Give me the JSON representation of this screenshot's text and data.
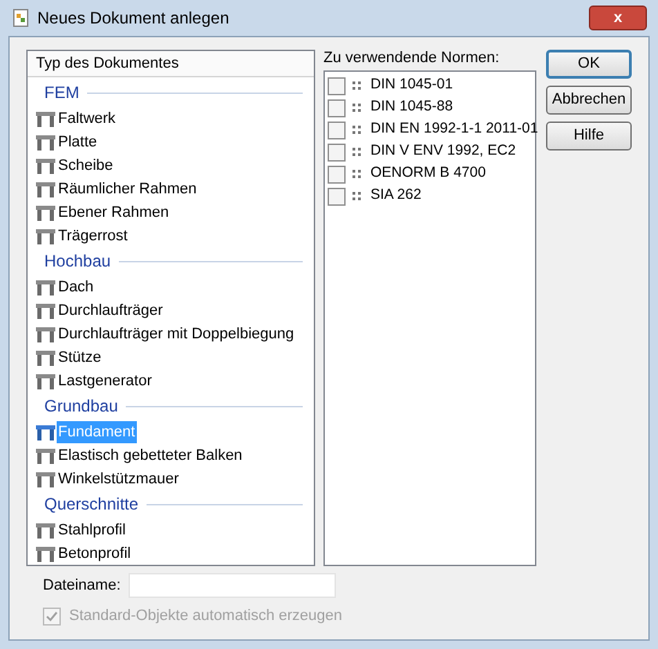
{
  "window": {
    "title": "Neues Dokument anlegen",
    "close": "x"
  },
  "document_types": {
    "header": "Typ des Dokumentes",
    "groups": [
      {
        "title": "FEM",
        "items": [
          {
            "label": "Faltwerk",
            "selected": false
          },
          {
            "label": "Platte",
            "selected": false
          },
          {
            "label": "Scheibe",
            "selected": false
          },
          {
            "label": "Räumlicher Rahmen",
            "selected": false
          },
          {
            "label": "Ebener Rahmen",
            "selected": false
          },
          {
            "label": "Trägerrost",
            "selected": false
          }
        ]
      },
      {
        "title": "Hochbau",
        "items": [
          {
            "label": "Dach",
            "selected": false
          },
          {
            "label": "Durchlaufträger",
            "selected": false
          },
          {
            "label": "Durchlaufträger mit Doppelbiegung",
            "selected": false
          },
          {
            "label": "Stütze",
            "selected": false
          },
          {
            "label": "Lastgenerator",
            "selected": false
          }
        ]
      },
      {
        "title": "Grundbau",
        "items": [
          {
            "label": "Fundament",
            "selected": true
          },
          {
            "label": "Elastisch gebetteter Balken",
            "selected": false
          },
          {
            "label": "Winkelstützmauer",
            "selected": false
          }
        ]
      },
      {
        "title": "Querschnitte",
        "items": [
          {
            "label": "Stahlprofil",
            "selected": false
          },
          {
            "label": "Betonprofil",
            "selected": false
          }
        ]
      }
    ]
  },
  "norms": {
    "label": "Zu verwendende Normen:",
    "items": [
      {
        "label": "DIN 1045-01",
        "checked": false
      },
      {
        "label": "DIN 1045-88",
        "checked": false
      },
      {
        "label": "DIN EN 1992-1-1 2011-01",
        "checked": false
      },
      {
        "label": "DIN V ENV 1992, EC2",
        "checked": false
      },
      {
        "label": "OENORM B 4700",
        "checked": false
      },
      {
        "label": "SIA 262",
        "checked": false
      }
    ]
  },
  "buttons": [
    {
      "label": "OK",
      "default": true
    },
    {
      "label": "Abbrechen",
      "default": false
    },
    {
      "label": "Hilfe",
      "default": false
    }
  ],
  "filename": {
    "label": "Dateiname:"
  },
  "auto_create": {
    "label": "Standard-Objekte automatisch erzeugen",
    "checked": true,
    "disabled": true
  }
}
